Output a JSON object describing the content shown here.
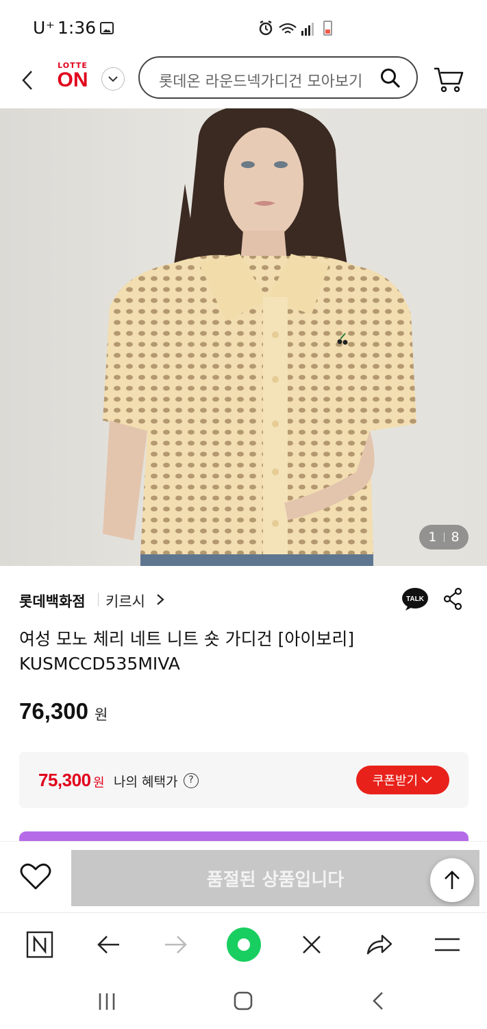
{
  "status": {
    "carrier": "U⁺",
    "time": "1:36"
  },
  "header": {
    "logo_top": "LOTTE",
    "logo_main": "ON",
    "search_placeholder": "롯데온 라운드넥가디건 모아보기",
    "brand_color": "#e0001b"
  },
  "gallery": {
    "current": "1",
    "total": "8"
  },
  "product": {
    "store": "롯데백화점",
    "brand": "키르시",
    "title_line1": "여성 모노 체리 네트 니트 숏 가디건 [아이보리]",
    "title_line2": "KUSMCCD535MIVA",
    "price": "76,300",
    "currency": "원"
  },
  "benefit": {
    "price": "75,300",
    "currency": "원",
    "label": "나의 혜택가",
    "help": "?",
    "coupon_label": "쿠폰받기"
  },
  "actions": {
    "soldout_label": "품절된 상품입니다"
  },
  "browser": {
    "icons": [
      "naver-n-icon",
      "back-arrow-icon",
      "forward-arrow-icon",
      "green-dot-icon",
      "close-icon",
      "share-icon",
      "menu-icon"
    ]
  },
  "colors": {
    "accent": "#e0001b",
    "coupon": "#e8221b",
    "soldout": "#c7c7c7",
    "promo_strip": "#b56be8"
  }
}
